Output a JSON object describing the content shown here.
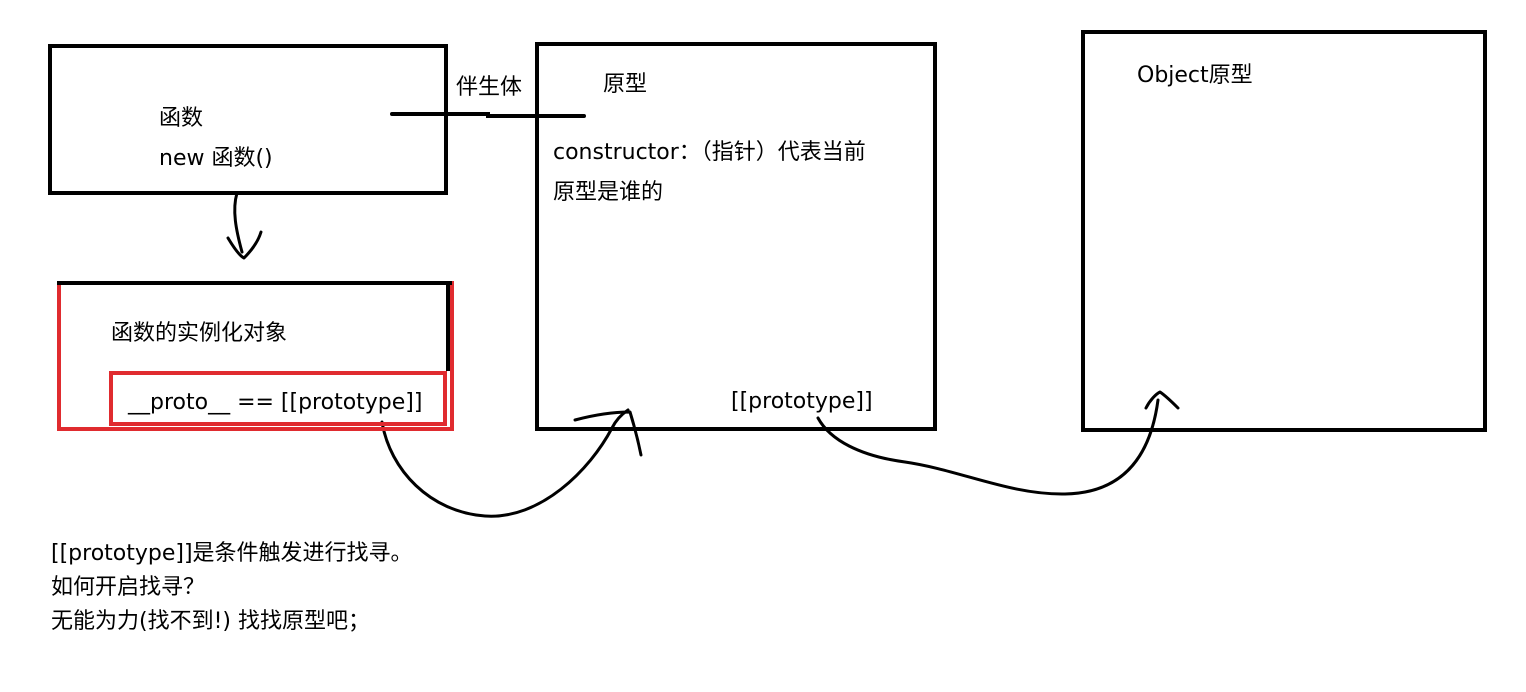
{
  "function_box": {
    "line1": "函数",
    "line2": "new 函数()"
  },
  "companion_label": "伴生体",
  "prototype_box": {
    "title": "原型",
    "constructor_line1": "constructor：（指针）代表当前",
    "constructor_line2": "原型是谁的",
    "link": "[[prototype]]"
  },
  "object_box": {
    "title": "Object原型"
  },
  "instance_box": {
    "title": "函数的实例化对象",
    "proto": "__proto__  == [[prototype]]"
  },
  "notes": [
    "[[prototype]]是条件触发进行找寻。",
    "如何开启找寻？",
    "无能为力(找不到!) 找找原型吧；"
  ],
  "colors": {
    "ink": "#000000",
    "highlight": "#e02b2f"
  }
}
